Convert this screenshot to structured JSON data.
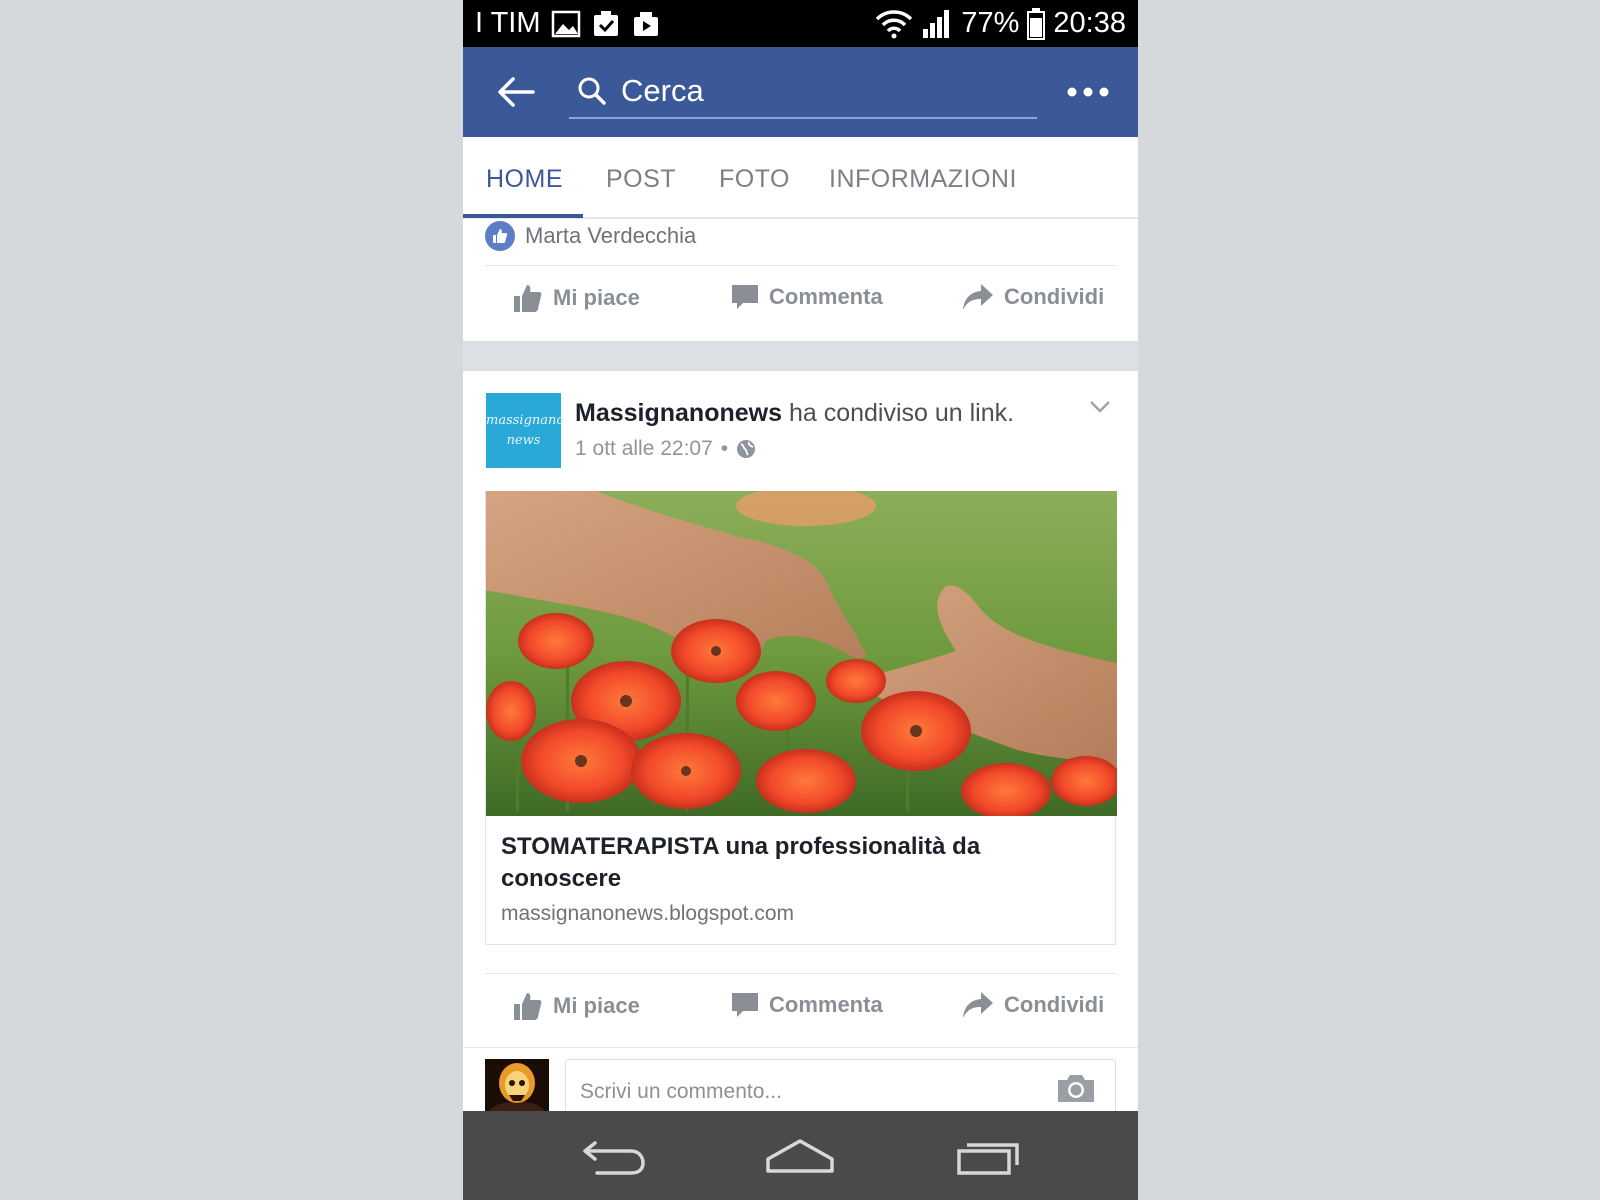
{
  "status_bar": {
    "carrier": "I TIM",
    "battery": "77%",
    "time": "20:38"
  },
  "app_bar": {
    "search_text": "Cerca"
  },
  "tabs": [
    {
      "label": "HOME",
      "active": true
    },
    {
      "label": "POST",
      "active": false
    },
    {
      "label": "FOTO",
      "active": false
    },
    {
      "label": "INFORMAZIONI",
      "active": false
    }
  ],
  "first_post": {
    "liker_name": "Marta Verdecchia",
    "actions": {
      "like": "Mi piace",
      "comment": "Commenta",
      "share": "Condividi"
    }
  },
  "second_post": {
    "avatar_text": [
      "massignano",
      "news"
    ],
    "author": "Massignanonews",
    "action_text": "ha condiviso un link.",
    "timestamp": "1 ott alle 22:07",
    "link": {
      "title": "STOMATERAPISTA una professionalità da conoscere",
      "domain": "massignanonews.blogspot.com"
    },
    "actions": {
      "like": "Mi piace",
      "comment": "Commenta",
      "share": "Condividi"
    },
    "comment_placeholder": "Scrivi un commento..."
  },
  "colors": {
    "facebook_blue": "#3b5998",
    "tab_active": "#3b5998",
    "action_gray": "#8a8f96",
    "page_avatar": "#2aa8d8"
  }
}
